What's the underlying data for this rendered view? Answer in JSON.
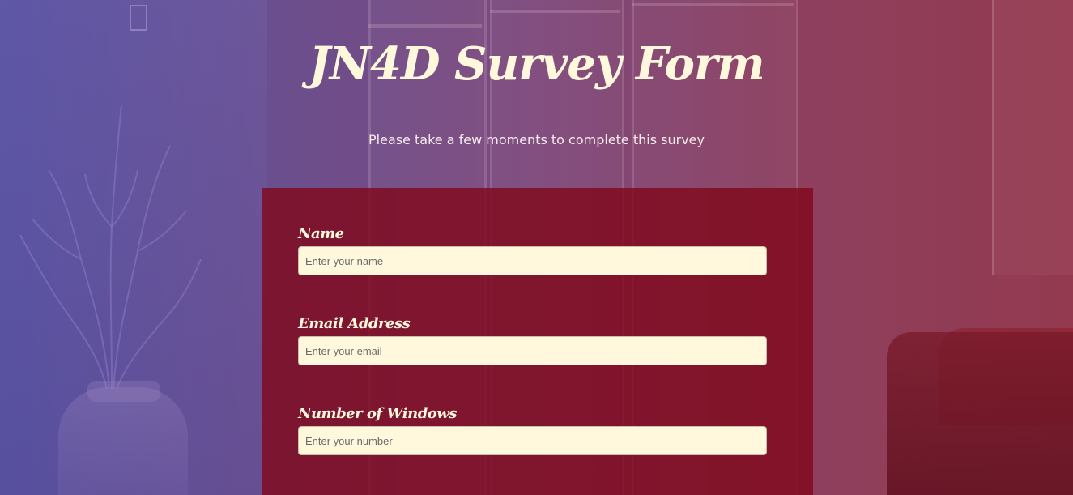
{
  "header": {
    "title": "JN4D Survey Form",
    "description": "Please take a few moments to complete this survey"
  },
  "form": {
    "fields": [
      {
        "label": "Name",
        "placeholder": "Enter your name",
        "type": "text"
      },
      {
        "label": "Email Address",
        "placeholder": "Enter your email",
        "type": "email"
      },
      {
        "label": "Number of Windows",
        "placeholder": "Enter your number",
        "type": "number"
      }
    ]
  },
  "colors": {
    "panel": "#80081c",
    "text_cream": "#fff8dc",
    "input_bg": "#fff8dc"
  }
}
